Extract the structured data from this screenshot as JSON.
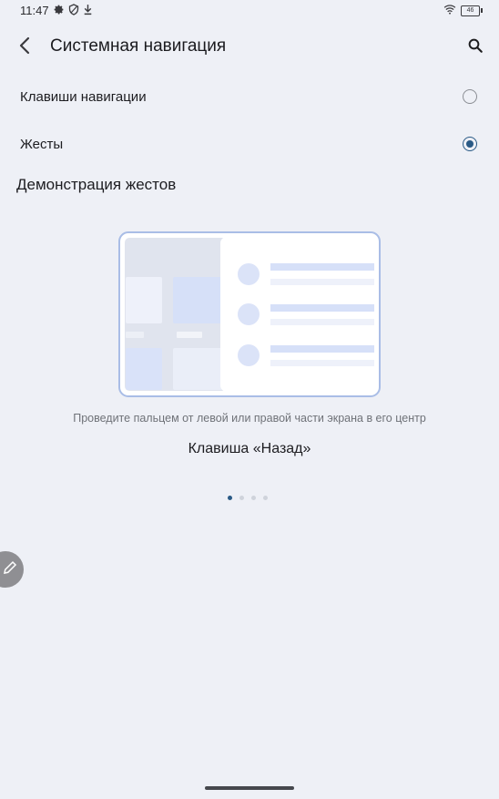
{
  "status_bar": {
    "time": "11:47",
    "battery": "46",
    "left_icons": [
      "gear-icon",
      "shield-icon",
      "download-icon"
    ],
    "right_icons": [
      "wifi-icon",
      "battery-icon"
    ]
  },
  "app_bar": {
    "title": "Системная навигация",
    "back_icon": "back-arrow-icon",
    "search_icon": "search-icon"
  },
  "options": [
    {
      "label": "Клавиши навигации",
      "selected": false
    },
    {
      "label": "Жесты",
      "selected": true
    }
  ],
  "demo": {
    "section_title": "Демонстрация жестов",
    "caption": "Проведите пальцем от левой или правой части экрана в его центр",
    "gesture_name": "Клавиша «Назад»",
    "page_count": 4,
    "current_page": 1
  },
  "colors": {
    "accent": "#2a5a86",
    "background": "#eef0f6"
  }
}
